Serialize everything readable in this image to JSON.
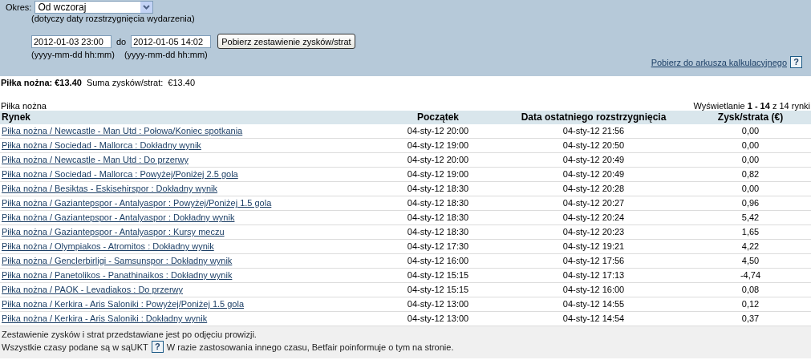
{
  "filter": {
    "period_label": "Okres:",
    "period_value": "Od wczoraj",
    "period_hint": "(dotyczy daty rozstrzygnięcia wydarzenia)",
    "from_value": "2012-01-03 23:00",
    "to_label": "do",
    "to_value": "2012-01-05 14:02",
    "from_hint": "(yyyy-mm-dd hh:mm)",
    "to_hint": "(yyyy-mm-dd hh:mm)",
    "submit_button": "Pobierz zestawienie zysków/strat",
    "export_link": "Pobierz do arkusza kalkulacyjnego",
    "export_help": "?"
  },
  "summary": {
    "sport_total": "Piłka nożna: €13.40",
    "sum_label": "Suma zysków/strat:  €13.40"
  },
  "table": {
    "caption": "Piłka nożna",
    "paging": "Wyświetlanie **1 - 14** z 14 rynki",
    "columns": [
      "Rynek",
      "Początek",
      "Data ostatniego rozstrzygnięcia",
      "Zysk/strata (€)"
    ],
    "rows": [
      [
        "Piłka nożna / Newcastle - Man Utd : Połowa/Koniec spotkania",
        "04-sty-12 20:00",
        "04-sty-12 21:56",
        "0,00"
      ],
      [
        "Piłka nożna / Sociedad - Mallorca : Dokładny wynik",
        "04-sty-12 19:00",
        "04-sty-12 20:50",
        "0,00"
      ],
      [
        "Piłka nożna / Newcastle - Man Utd : Do przerwy",
        "04-sty-12 20:00",
        "04-sty-12 20:49",
        "0,00"
      ],
      [
        "Piłka nożna / Sociedad - Mallorca : Powyżej/Poniżej 2.5 gola",
        "04-sty-12 19:00",
        "04-sty-12 20:49",
        "0,82"
      ],
      [
        "Piłka nożna / Besiktas - Eskisehirspor : Dokładny wynik",
        "04-sty-12 18:30",
        "04-sty-12 20:28",
        "0,00"
      ],
      [
        "Piłka nożna / Gaziantepspor - Antalyaspor : Powyżej/Poniżej 1.5 gola",
        "04-sty-12 18:30",
        "04-sty-12 20:27",
        "0,96"
      ],
      [
        "Piłka nożna / Gaziantepspor - Antalyaspor : Dokładny wynik",
        "04-sty-12 18:30",
        "04-sty-12 20:24",
        "5,42"
      ],
      [
        "Piłka nożna / Gaziantepspor - Antalyaspor : Kursy meczu",
        "04-sty-12 18:30",
        "04-sty-12 20:23",
        "1,65"
      ],
      [
        "Piłka nożna / Olympiakos - Atromitos : Dokładny wynik",
        "04-sty-12 17:30",
        "04-sty-12 19:21",
        "4,22"
      ],
      [
        "Piłka nożna / Genclerbirligi - Samsunspor : Dokładny wynik",
        "04-sty-12 16:00",
        "04-sty-12 17:56",
        "4,50"
      ],
      [
        "Piłka nożna / Panetolikos - Panathinaikos : Dokładny wynik",
        "04-sty-12 15:15",
        "04-sty-12 17:13",
        "-4,74"
      ],
      [
        "Piłka nożna / PAOK - Levadiakos : Do przerwy",
        "04-sty-12 15:15",
        "04-sty-12 16:00",
        "0,08"
      ],
      [
        "Piłka nożna / Kerkira - Aris Saloniki : Powyżej/Poniżej 1.5 gola",
        "04-sty-12 13:00",
        "04-sty-12 14:55",
        "0,12"
      ],
      [
        "Piłka nożna / Kerkira - Aris Saloniki : Dokładny wynik",
        "04-sty-12 13:00",
        "04-sty-12 14:54",
        "0,37"
      ]
    ]
  },
  "footer": {
    "note": "Zestawienie zysków i strat przedstawiane jest po odjęciu prowizji.",
    "timezone_text": "Wszystkie czasy podane są w sąUKT",
    "timezone_help": "?",
    "timezone_note": "W razie zastosowania innego czasu, Betfair poinformuje o tym na stronie."
  }
}
